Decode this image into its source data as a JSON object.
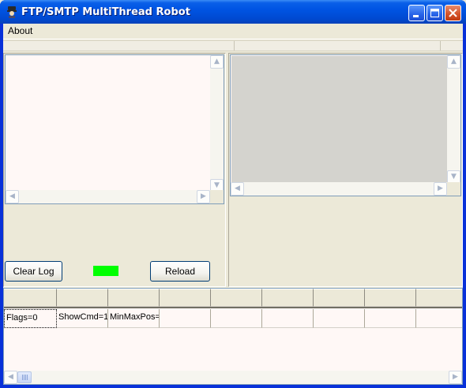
{
  "window": {
    "title": "FTP/SMTP MultiThread Robot",
    "icons": [
      "app-icon",
      "minimize-icon",
      "maximize-icon",
      "close-icon"
    ]
  },
  "menu": {
    "items": [
      {
        "label": "About"
      }
    ]
  },
  "left_panel": {
    "clear_log_label": "Clear Log",
    "reload_label": "Reload",
    "status_indicator_color": "#00ff00"
  },
  "grid": {
    "header": [
      "",
      "",
      "",
      "",
      "",
      "",
      "",
      "",
      ""
    ],
    "rows": [
      [
        "Flags=0",
        "ShowCmd=1",
        "MinMaxPos=",
        "",
        "",
        "",
        "",
        "",
        ""
      ]
    ]
  },
  "colors": {
    "titlebar": "#0054e3",
    "client_bg": "#ece9d8",
    "preview_bg": "#d4d3ce",
    "log_bg": "#fff8f6"
  }
}
